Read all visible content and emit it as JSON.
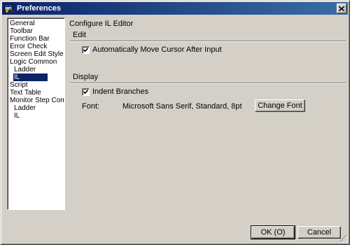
{
  "window": {
    "title": "Preferences",
    "icon": "preferences-app-icon",
    "close_symbol": "✕"
  },
  "sidebar": {
    "items": [
      {
        "label": "General",
        "level": 0,
        "selected": false
      },
      {
        "label": "Toolbar",
        "level": 0,
        "selected": false
      },
      {
        "label": "Function Bar",
        "level": 0,
        "selected": false
      },
      {
        "label": "Error Check",
        "level": 0,
        "selected": false
      },
      {
        "label": "Screen Edit Style",
        "level": 0,
        "selected": false
      },
      {
        "label": "Logic Common",
        "level": 0,
        "selected": false
      },
      {
        "label": "Ladder",
        "level": 1,
        "selected": false
      },
      {
        "label": "IL",
        "level": 1,
        "selected": true
      },
      {
        "label": "Script",
        "level": 0,
        "selected": false
      },
      {
        "label": "Text Table",
        "level": 0,
        "selected": false
      },
      {
        "label": "Monitor Step Commor",
        "level": 0,
        "selected": false
      },
      {
        "label": "Ladder",
        "level": 1,
        "selected": false
      },
      {
        "label": "IL",
        "level": 1,
        "selected": false
      }
    ]
  },
  "main": {
    "title": "Configure IL Editor",
    "edit_section": {
      "label": "Edit",
      "auto_move_cursor": {
        "label": "Automatically Move Cursor After Input",
        "checked": true
      }
    },
    "display_section": {
      "label": "Display",
      "indent_branches": {
        "label": "Indent Branches",
        "checked": true
      },
      "font_label": "Font:",
      "font_value": "Microsoft Sans Serif, Standard, 8pt",
      "change_font_button": "Change Font"
    }
  },
  "footer": {
    "ok_button": "OK (O)",
    "cancel_button": "Cancel"
  },
  "colors": {
    "titlebar_start": "#0a246a",
    "titlebar_end": "#3a6ea5",
    "face": "#d4d0c8",
    "selection": "#0a246a"
  }
}
